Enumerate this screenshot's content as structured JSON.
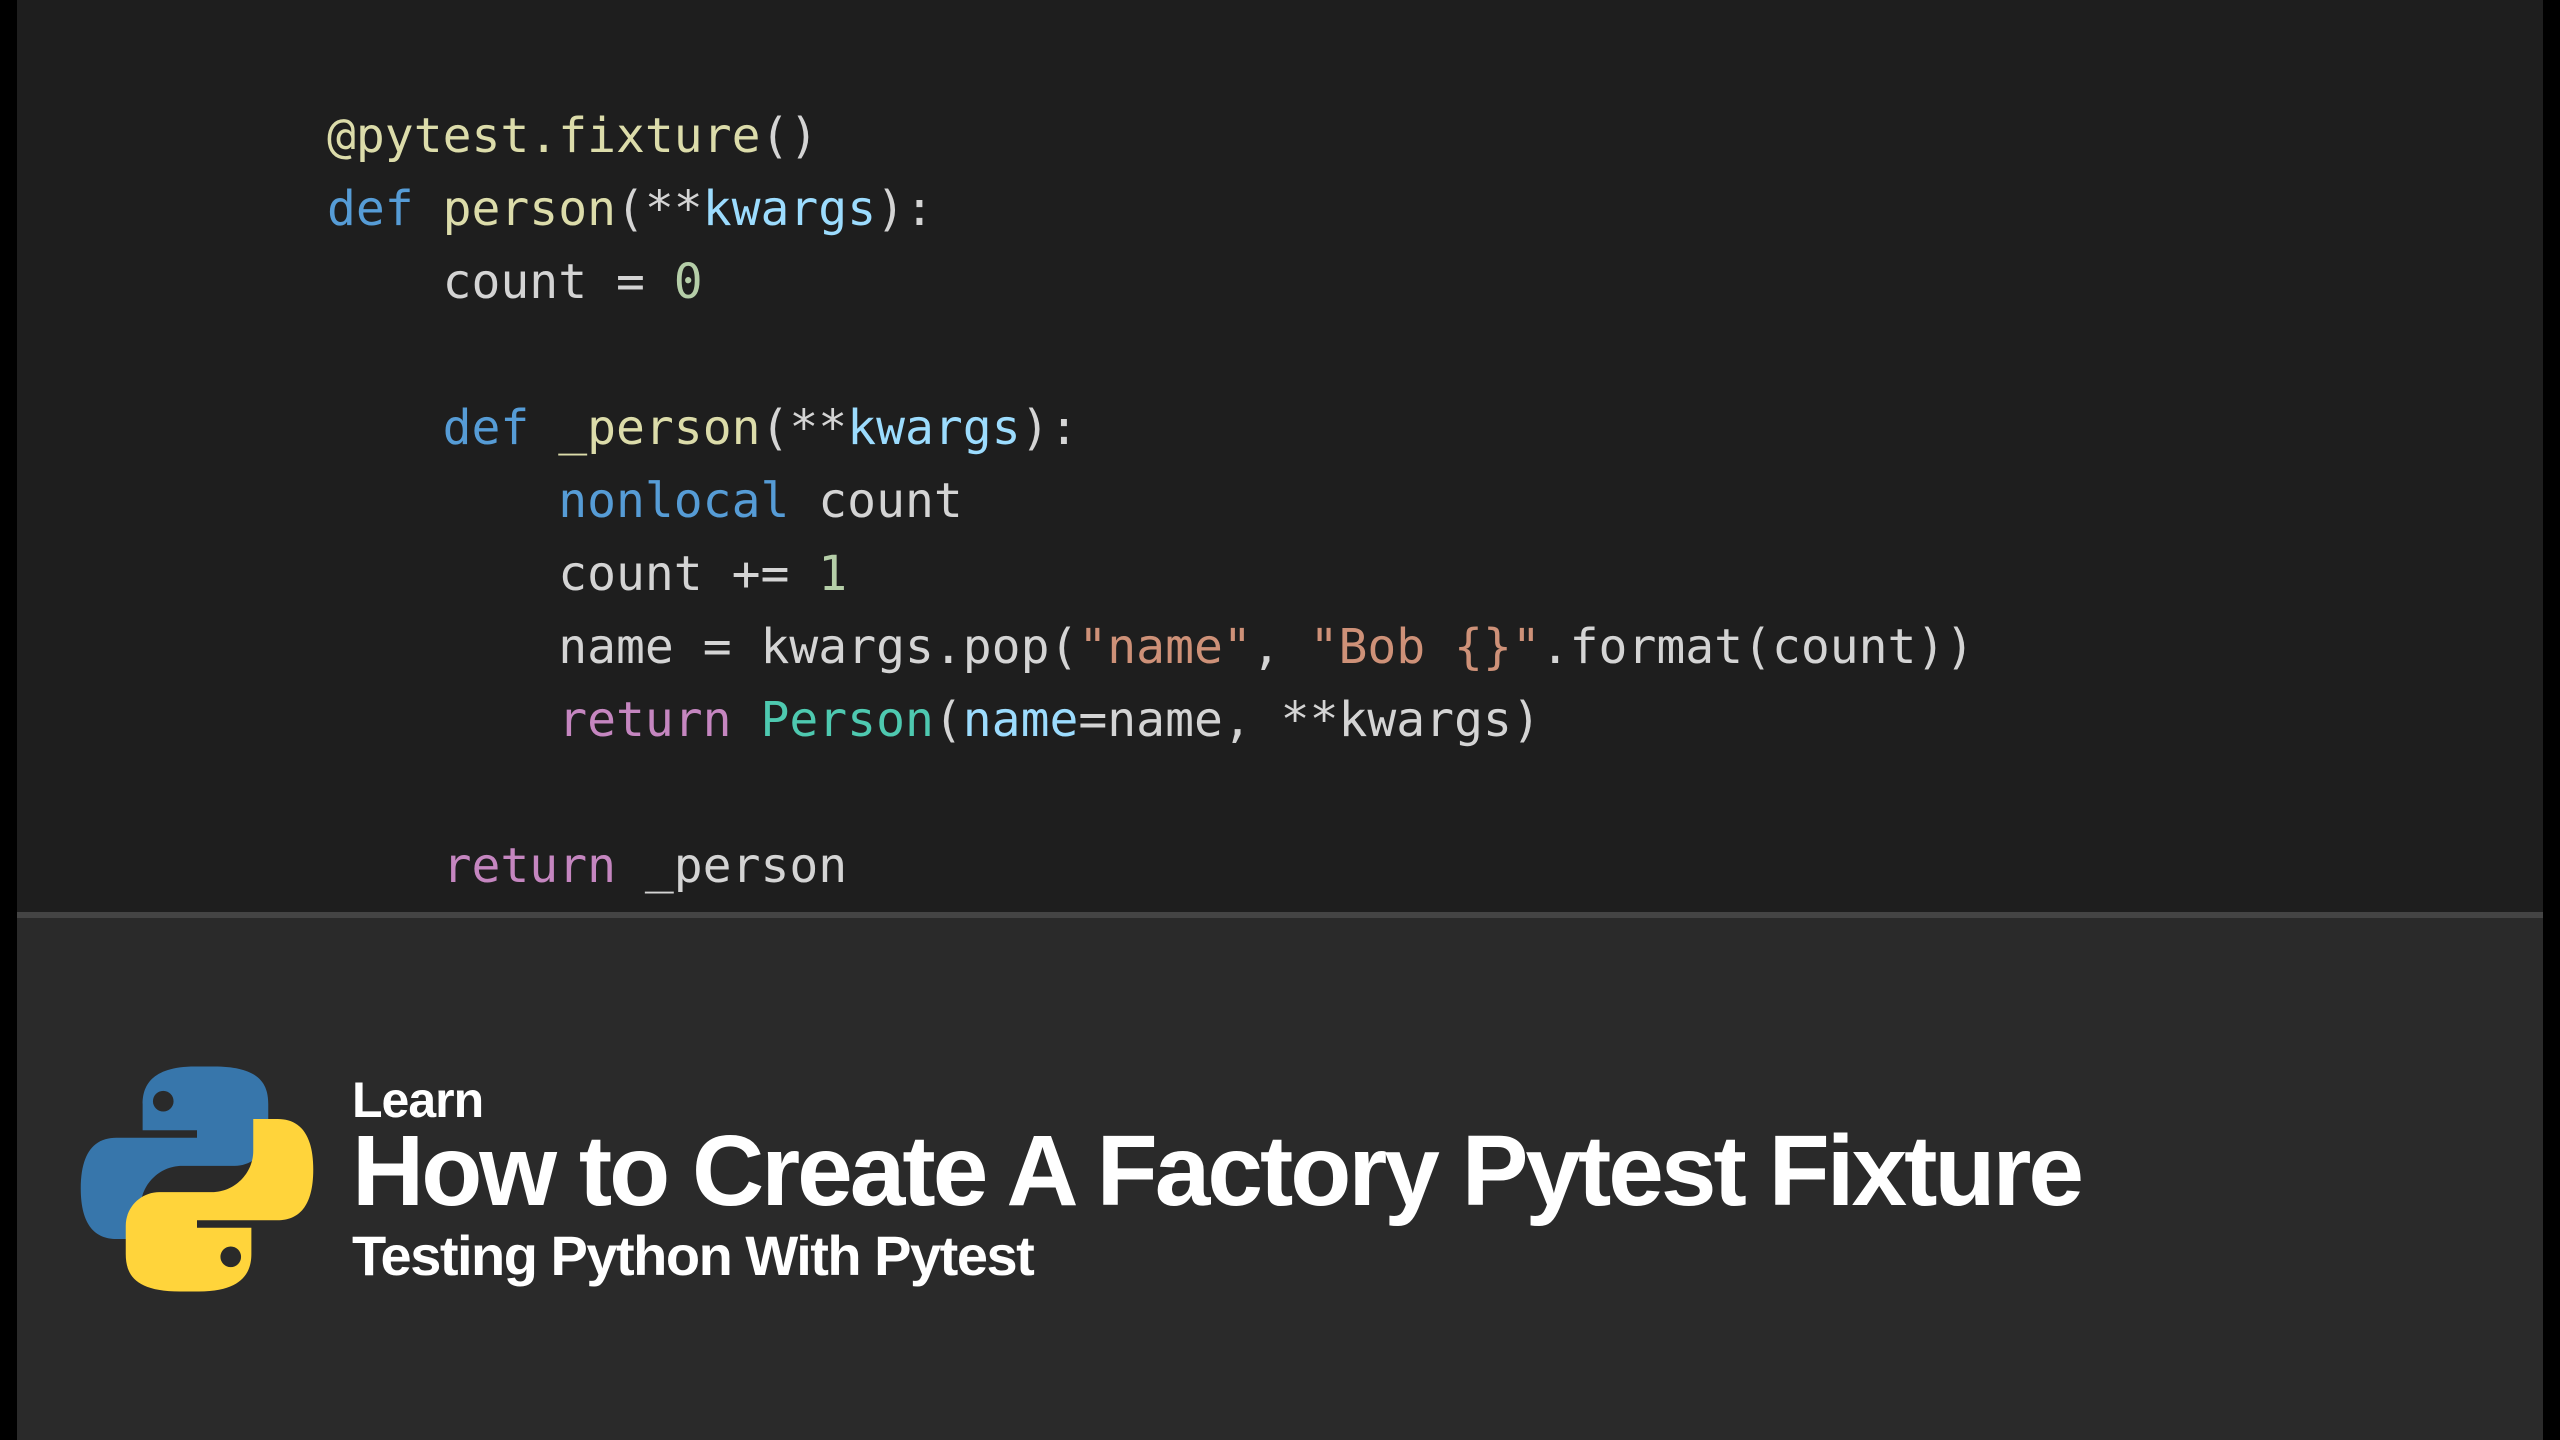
{
  "code": {
    "l1": {
      "at": "@",
      "decorator": "pytest.fixture",
      "parens": "()"
    },
    "l2": {
      "def": "def",
      "fn": "person",
      "open": "(",
      "stars": "**",
      "kw": "kwargs",
      "close": "):"
    },
    "l3": {
      "ident": "count",
      "eq": " = ",
      "zero": "0"
    },
    "l5": {
      "def": "def",
      "fn": "_person",
      "open": "(",
      "stars": "**",
      "kw": "kwargs",
      "close": "):"
    },
    "l6": {
      "nonlocal": "nonlocal",
      "ident": " count"
    },
    "l7": {
      "lhs": "count ",
      "op": "+=",
      "one": " 1"
    },
    "l8": {
      "lhs": "name ",
      "eq": "=",
      "mid": " kwargs.pop(",
      "s1": "\"name\"",
      "comma": ", ",
      "s2": "\"Bob {}\"",
      "fmt": ".format(count))"
    },
    "l9": {
      "ret": "return",
      "sp": " ",
      "cls": "Person",
      "open": "(",
      "kwarg": "name",
      "eq": "=",
      "rhs": "name, ",
      "stars": "**",
      "kw": "kwargs)"
    },
    "l11": {
      "ret": "return",
      "sp": " _person"
    }
  },
  "logo": {
    "blue": "#3776ab",
    "yellow": "#ffd43b"
  },
  "titles": {
    "kicker": "Learn",
    "headline": "How to Create A Factory Pytest Fixture",
    "subtitle": "Testing Python With Pytest"
  }
}
